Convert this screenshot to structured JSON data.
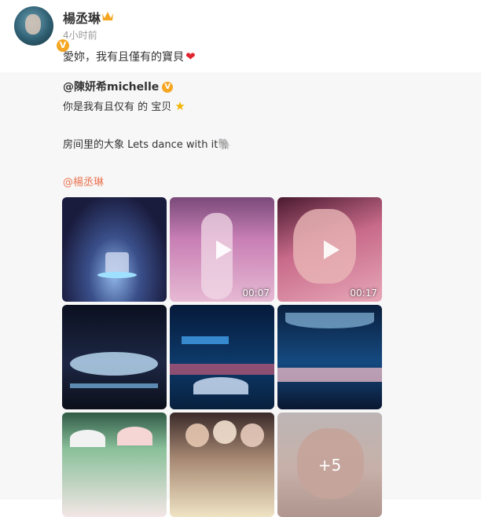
{
  "post": {
    "username": "楊丞琳",
    "time": "4小时前",
    "text": "愛妳，我有且僅有的寶貝",
    "heart_icon": "red-heart"
  },
  "repost": {
    "username": "@陳妍希michelle",
    "line1": "你是我有且仅有 的 宝贝",
    "line2": "房间里的大象 Lets dance with it",
    "mention": "@楊丞琳"
  },
  "media": [
    {
      "type": "image"
    },
    {
      "type": "video",
      "duration": "00:07"
    },
    {
      "type": "video",
      "duration": "00:17"
    },
    {
      "type": "image"
    },
    {
      "type": "image"
    },
    {
      "type": "image"
    },
    {
      "type": "image"
    },
    {
      "type": "image"
    },
    {
      "type": "image",
      "more": "+5"
    }
  ]
}
